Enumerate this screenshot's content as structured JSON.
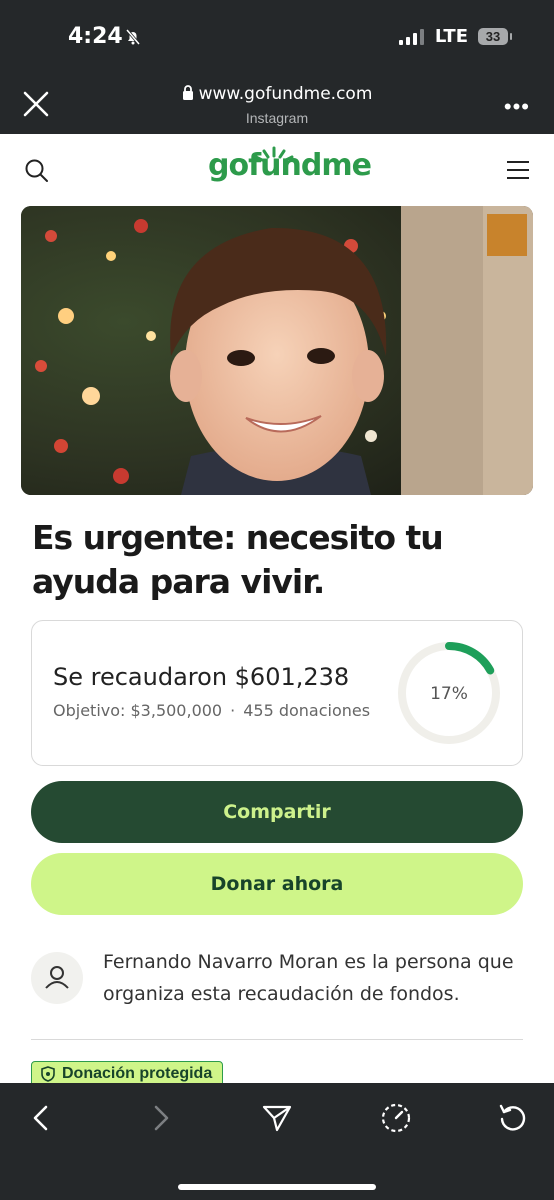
{
  "status_bar": {
    "time": "4:24",
    "network": "LTE",
    "battery": "33"
  },
  "browser": {
    "url": "www.gofundme.com",
    "source": "Instagram"
  },
  "site": {
    "logo": "gofundme"
  },
  "campaign": {
    "title": "Es urgente: necesito tu ayuda para vivir.",
    "raised_text": "Se recaudaron $601,238",
    "goal_text": "Objetivo: $3,500,000",
    "separator": "·",
    "donations_text": "455 donaciones",
    "progress_label": "17%",
    "progress_fraction": 0.17
  },
  "actions": {
    "share_label": "Compartir",
    "donate_label": "Donar ahora"
  },
  "organizer": {
    "text": "Fernando Navarro Moran es la persona que organiza esta recaudación de fondos."
  },
  "badge": {
    "label": "Donación protegida"
  },
  "colors": {
    "brand_green": "#2d9b4b",
    "dark_green": "#254a32",
    "lime": "#cff589",
    "chrome": "#25282a"
  }
}
